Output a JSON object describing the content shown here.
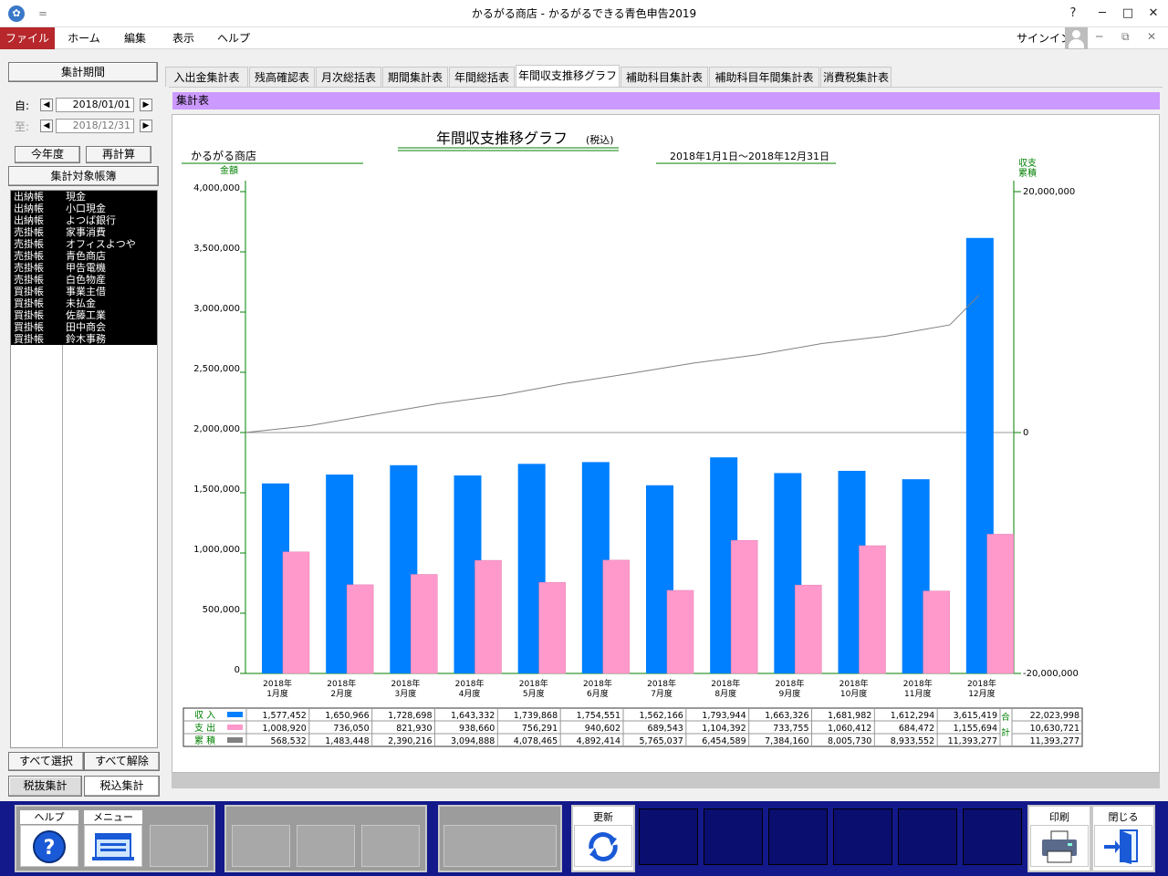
{
  "app": {
    "title": "かるがる商店 - かるがるできる青色申告2019",
    "quick_access": "＝",
    "icon": "app-logo-icon"
  },
  "window_controls": {
    "help": "?",
    "minimize": "─",
    "maximize": "□",
    "close": "✕"
  },
  "menu": {
    "file": "ファイル",
    "home": "ホーム",
    "edit": "編集",
    "view": "表示",
    "help": "ヘルプ",
    "signin": "サインイン",
    "ribbon_min": "─",
    "ribbon_restore": "⧉",
    "ribbon_close": "✕"
  },
  "sidebar": {
    "period_header": "集計期間",
    "from_label": "自:",
    "to_label": "至:",
    "from_date": "2018/01/01",
    "to_date": "2018/12/31",
    "this_year": "今年度",
    "recalc": "再計算",
    "ledger_header": "集計対象帳簿",
    "accounts": [
      {
        "type": "出納帳",
        "name": "現金"
      },
      {
        "type": "出納帳",
        "name": "小口現金"
      },
      {
        "type": "出納帳",
        "name": "よつば銀行"
      },
      {
        "type": "売掛帳",
        "name": "家事消費"
      },
      {
        "type": "売掛帳",
        "name": "オフィスよつや"
      },
      {
        "type": "売掛帳",
        "name": "青色商店"
      },
      {
        "type": "売掛帳",
        "name": "甲告電機"
      },
      {
        "type": "売掛帳",
        "name": "白色物産"
      },
      {
        "type": "買掛帳",
        "name": "事業主借"
      },
      {
        "type": "買掛帳",
        "name": "未払金"
      },
      {
        "type": "買掛帳",
        "name": "佐藤工業"
      },
      {
        "type": "買掛帳",
        "name": "田中商会"
      },
      {
        "type": "買掛帳",
        "name": "鈴木事務"
      }
    ],
    "select_all": "すべて選択",
    "deselect_all": "すべて解除",
    "tax_excl": "税抜集計",
    "tax_incl": "税込集計"
  },
  "tabs": [
    "入出金集計表",
    "残高確認表",
    "月次総括表",
    "期間集計表",
    "年間総括表",
    "年間収支推移グラフ",
    "補助科目集計表",
    "補助科目年間集計表",
    "消費税集計表"
  ],
  "active_tab": 5,
  "section_title": "集計表",
  "colors": {
    "income": "#0080ff",
    "expense": "#ff99cc",
    "cumulative": "#808080",
    "axis": "#008000",
    "section": "#cc99ff",
    "toolbar": "#13198a"
  },
  "chart_data": {
    "type": "bar",
    "title": "年間収支推移グラフ",
    "title_suffix": "(税込)",
    "shop": "かるがる商店",
    "period": "2018年1月1日～2018年12月31日",
    "ylabel": "金額",
    "y2label_1": "収支",
    "y2label_2": "累積",
    "ylim": [
      0,
      4000000
    ],
    "y2lim": [
      -20000000,
      20000000
    ],
    "yticks": [
      "0",
      "500,000",
      "1,000,000",
      "1,500,000",
      "2,000,000",
      "2,500,000",
      "3,000,000",
      "3,500,000",
      "4,000,000"
    ],
    "y2ticks": [
      "-20,000,000",
      "0",
      "20,000,000"
    ],
    "grid": false,
    "categories": [
      {
        "year": "2018年",
        "month": "1月度"
      },
      {
        "year": "2018年",
        "month": "2月度"
      },
      {
        "year": "2018年",
        "month": "3月度"
      },
      {
        "year": "2018年",
        "month": "4月度"
      },
      {
        "year": "2018年",
        "month": "5月度"
      },
      {
        "year": "2018年",
        "month": "6月度"
      },
      {
        "year": "2018年",
        "month": "7月度"
      },
      {
        "year": "2018年",
        "month": "8月度"
      },
      {
        "year": "2018年",
        "month": "9月度"
      },
      {
        "year": "2018年",
        "month": "10月度"
      },
      {
        "year": "2018年",
        "month": "11月度"
      },
      {
        "year": "2018年",
        "month": "12月度"
      }
    ],
    "series": [
      {
        "name": "収 入",
        "values": [
          1577452,
          1650966,
          1728698,
          1643332,
          1739868,
          1754551,
          1562166,
          1793944,
          1663326,
          1681982,
          1612294,
          3615419
        ]
      },
      {
        "name": "支 出",
        "values": [
          1008920,
          736050,
          821930,
          938660,
          756291,
          940602,
          689543,
          1104392,
          733755,
          1060412,
          684472,
          1155694
        ]
      },
      {
        "name": "累 積",
        "axis": "right",
        "values": [
          568532,
          1483448,
          2390216,
          3094888,
          4078465,
          4892414,
          5765037,
          6454589,
          7384160,
          8005730,
          8933552,
          11393277
        ]
      }
    ],
    "table": {
      "rows": [
        {
          "label": "収 入",
          "values": [
            "1,577,452",
            "1,650,966",
            "1,728,698",
            "1,643,332",
            "1,739,868",
            "1,754,551",
            "1,562,166",
            "1,793,944",
            "1,663,326",
            "1,681,982",
            "1,612,294",
            "3,615,419"
          ],
          "total": "22,023,998"
        },
        {
          "label": "支 出",
          "values": [
            "1,008,920",
            "736,050",
            "821,930",
            "938,660",
            "756,291",
            "940,602",
            "689,543",
            "1,104,392",
            "733,755",
            "1,060,412",
            "684,472",
            "1,155,694"
          ],
          "total": "10,630,721"
        },
        {
          "label": "累 積",
          "values": [
            "568,532",
            "1,483,448",
            "2,390,216",
            "3,094,888",
            "4,078,465",
            "4,892,414",
            "5,765,037",
            "6,454,589",
            "7,384,160",
            "8,005,730",
            "8,933,552",
            "11,393,277"
          ],
          "total": "11,393,277"
        }
      ],
      "total_label_1": "合",
      "total_label_2": "計"
    }
  },
  "toolbar": {
    "help": "ヘルプ",
    "help_icon": "question-icon",
    "menu": "メニュー",
    "menu_icon": "menu-icon",
    "refresh": "更新",
    "refresh_icon": "refresh-icon",
    "print": "印刷",
    "print_icon": "printer-icon",
    "close": "閉じる",
    "close_icon": "exit-door-icon"
  }
}
